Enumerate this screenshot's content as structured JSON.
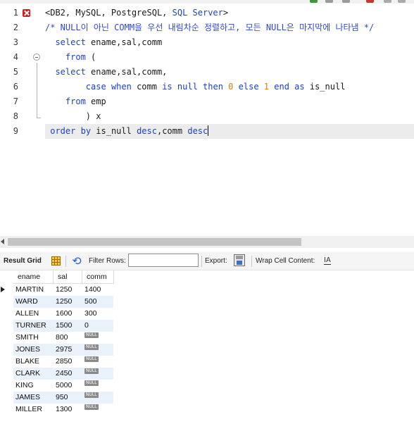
{
  "editor": {
    "lines": [
      {
        "num": "1",
        "parts": [
          {
            "t": "<DB2, MySQL, PostgreSQL, ",
            "c": "txt"
          },
          {
            "t": "SQL Server",
            "c": "kw"
          },
          {
            "t": ">",
            "c": "txt"
          }
        ]
      },
      {
        "num": "2",
        "parts": [
          {
            "t": "/* NULL이 아닌 COMM을 우선 내림차순 정렬하고, 모든 NULL은 마지막에 나타냄 */",
            "c": "cm"
          }
        ]
      },
      {
        "num": "3",
        "parts": [
          {
            "t": "  ",
            "c": "txt"
          },
          {
            "t": "select",
            "c": "kw"
          },
          {
            "t": " ename,sal,comm",
            "c": "txt"
          }
        ]
      },
      {
        "num": "4",
        "parts": [
          {
            "t": "    ",
            "c": "txt"
          },
          {
            "t": "from",
            "c": "kw"
          },
          {
            "t": " (",
            "c": "txt"
          }
        ]
      },
      {
        "num": "5",
        "parts": [
          {
            "t": "  ",
            "c": "txt"
          },
          {
            "t": "select",
            "c": "kw"
          },
          {
            "t": " ename,sal,comm,",
            "c": "txt"
          }
        ]
      },
      {
        "num": "6",
        "parts": [
          {
            "t": "        ",
            "c": "txt"
          },
          {
            "t": "case",
            "c": "kw"
          },
          {
            "t": " ",
            "c": "txt"
          },
          {
            "t": "when",
            "c": "kw"
          },
          {
            "t": " comm ",
            "c": "txt"
          },
          {
            "t": "is",
            "c": "kw"
          },
          {
            "t": " ",
            "c": "txt"
          },
          {
            "t": "null",
            "c": "kw"
          },
          {
            "t": " ",
            "c": "txt"
          },
          {
            "t": "then",
            "c": "kw"
          },
          {
            "t": " ",
            "c": "txt"
          },
          {
            "t": "0",
            "c": "num"
          },
          {
            "t": " ",
            "c": "txt"
          },
          {
            "t": "else",
            "c": "kw"
          },
          {
            "t": " ",
            "c": "txt"
          },
          {
            "t": "1",
            "c": "num"
          },
          {
            "t": " ",
            "c": "txt"
          },
          {
            "t": "end",
            "c": "kw"
          },
          {
            "t": " ",
            "c": "txt"
          },
          {
            "t": "as",
            "c": "kw"
          },
          {
            "t": " is_null",
            "c": "txt"
          }
        ]
      },
      {
        "num": "7",
        "parts": [
          {
            "t": "    ",
            "c": "txt"
          },
          {
            "t": "from",
            "c": "kw"
          },
          {
            "t": " emp",
            "c": "txt"
          }
        ]
      },
      {
        "num": "8",
        "parts": [
          {
            "t": "        ) x",
            "c": "txt"
          }
        ]
      },
      {
        "num": "9",
        "parts": [
          {
            "t": " ",
            "c": "txt"
          },
          {
            "t": "order",
            "c": "kw"
          },
          {
            "t": " ",
            "c": "txt"
          },
          {
            "t": "by",
            "c": "kw"
          },
          {
            "t": " is_null ",
            "c": "txt"
          },
          {
            "t": "desc",
            "c": "kw"
          },
          {
            "t": ",comm ",
            "c": "txt"
          },
          {
            "t": "desc",
            "c": "kw"
          }
        ]
      }
    ]
  },
  "result_toolbar": {
    "result_grid_label": "Result Grid",
    "filter_rows_label": "Filter Rows:",
    "filter_value": "",
    "export_label": "Export:",
    "wrap_label": "Wrap Cell Content:",
    "wrap_icon_glyph": "IA",
    "refresh_glyph": "⟲"
  },
  "grid": {
    "columns": [
      "ename",
      "sal",
      "comm"
    ],
    "null_label": "NULL",
    "rows": [
      {
        "ename": "MARTIN",
        "sal": "1250",
        "comm": "1400"
      },
      {
        "ename": "WARD",
        "sal": "1250",
        "comm": "500"
      },
      {
        "ename": "ALLEN",
        "sal": "1600",
        "comm": "300"
      },
      {
        "ename": "TURNER",
        "sal": "1500",
        "comm": "0"
      },
      {
        "ename": "SMITH",
        "sal": "800",
        "comm": null
      },
      {
        "ename": "JONES",
        "sal": "2975",
        "comm": null
      },
      {
        "ename": "BLAKE",
        "sal": "2850",
        "comm": null
      },
      {
        "ename": "CLARK",
        "sal": "2450",
        "comm": null
      },
      {
        "ename": "KING",
        "sal": "5000",
        "comm": null
      },
      {
        "ename": "JAMES",
        "sal": "950",
        "comm": null
      },
      {
        "ename": "MILLER",
        "sal": "1300",
        "comm": null
      }
    ]
  },
  "colors": {
    "keyword": "#1a3fd0",
    "comment": "#2f48ce",
    "number": "#e07e00",
    "error_marker": "#d71920",
    "row_alt": "#e9f1fb"
  },
  "icons": {
    "line1_marker": "error-icon",
    "line4_marker": "fold-icon",
    "grid_icon": "grid-icon",
    "refresh_icon": "refresh-icon",
    "export_icon": "export-icon",
    "wrap_icon": "wrap-text-icon"
  }
}
